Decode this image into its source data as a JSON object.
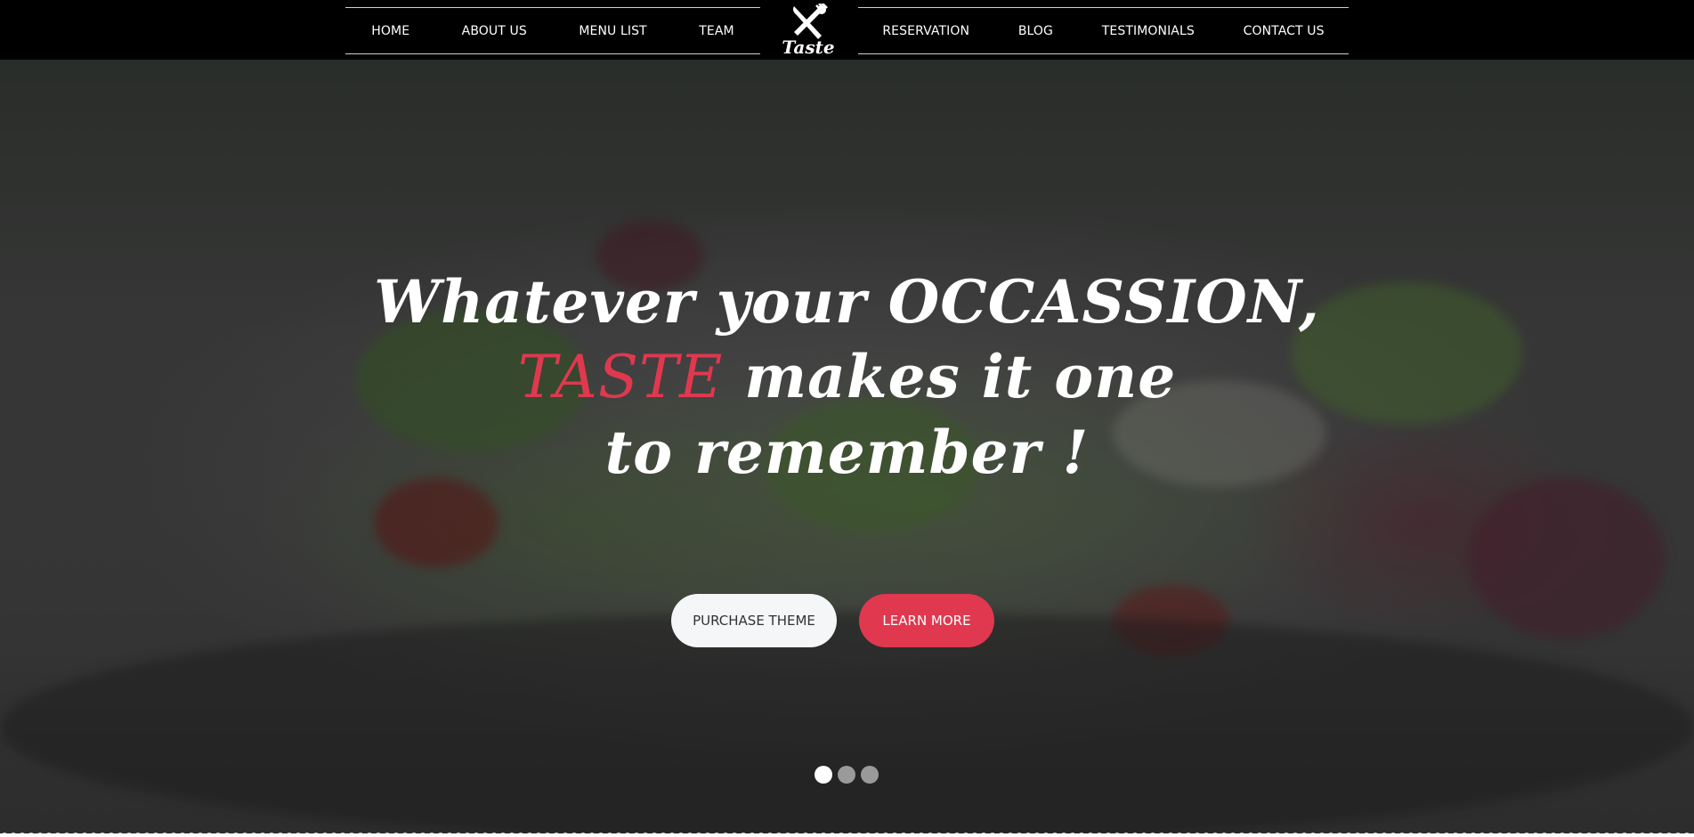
{
  "nav": {
    "left": [
      "HOME",
      "ABOUT US",
      "MENU LIST",
      "TEAM"
    ],
    "right": [
      "RESERVATION",
      "BLOG",
      "TESTIMONIALS",
      "CONTACT US"
    ]
  },
  "logo": {
    "text": "Taste",
    "icon": "fork-knife-icon"
  },
  "hero": {
    "line1": "Whatever your OCCASSION,",
    "line2_accent": "TASTE",
    "line2_rest": " makes it one",
    "line3": "to remember !"
  },
  "buttons": {
    "purchase": "PURCHASE THEME",
    "learn": "LEARN MORE"
  },
  "slider": {
    "total": 3,
    "active": 1
  },
  "colors": {
    "accent": "#e0384f",
    "nav_bg": "#000000",
    "button_light": "#f5f6f8"
  }
}
